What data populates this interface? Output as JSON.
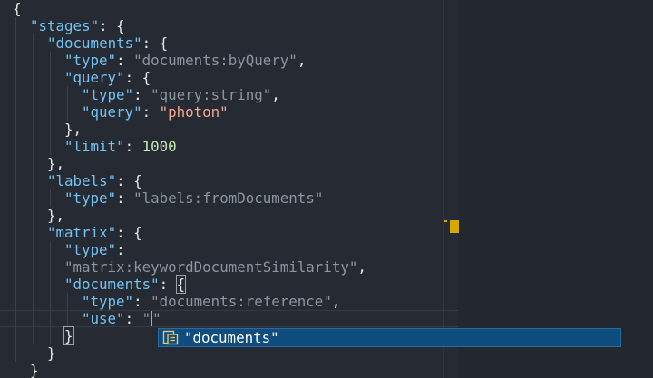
{
  "editor": {
    "code": {
      "brace_open": "{",
      "stages_key": "\"stages\"",
      "documents_key": "\"documents\"",
      "type_key": "\"type\"",
      "documents_type_value": "\"documents:byQuery\"",
      "query_key": "\"query\"",
      "query_type_value": "\"query:string\"",
      "query_value": "\"photon\"",
      "limit_key": "\"limit\"",
      "limit_value": "1000",
      "labels_key": "\"labels\"",
      "labels_type_value": "\"labels:fromDocuments\"",
      "matrix_key": "\"matrix\"",
      "matrix_type_value": "\"matrix:keywordDocumentSimilarity\"",
      "reference_type_value": "\"documents:reference\"",
      "use_key": "\"use\"",
      "use_partial_value": "\""
    }
  },
  "autocomplete": {
    "icon": "property-snippet-icon",
    "suggestion": "\"documents\""
  },
  "colors": {
    "background": "#262a33",
    "key": "#72c3f2",
    "string": "#8c96a1",
    "highlighted_string": "#f2a98f",
    "number": "#c7e9b4",
    "autocomplete_bg": "#0f4d7e",
    "marker": "#d7a700"
  }
}
